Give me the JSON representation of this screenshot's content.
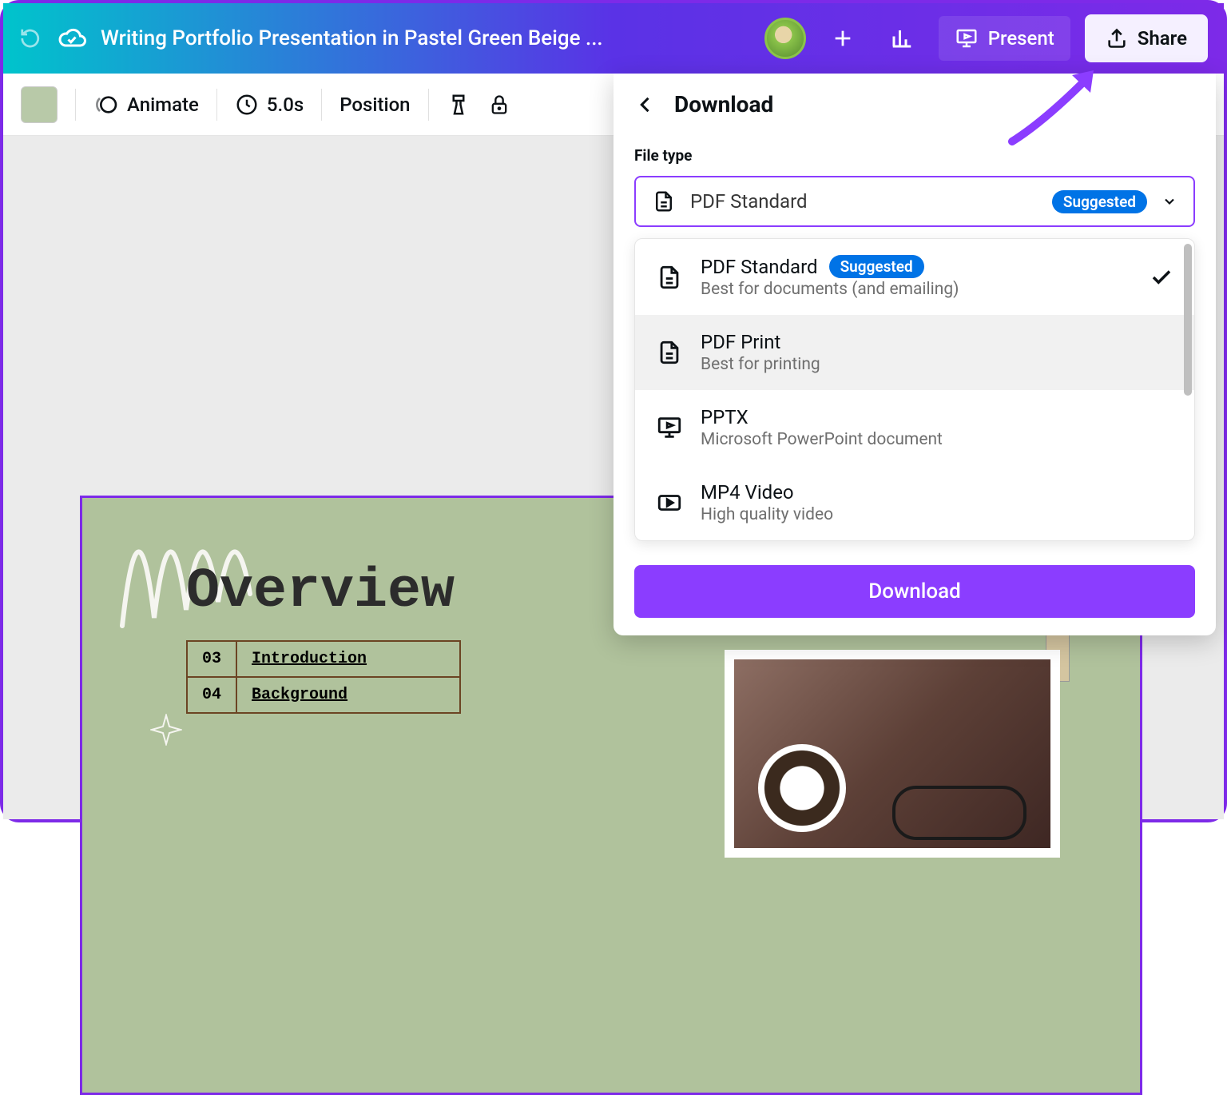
{
  "header": {
    "doc_title": "Writing Portfolio Presentation in Pastel Green Beige ...",
    "present_label": "Present",
    "share_label": "Share"
  },
  "toolbar": {
    "animate_label": "Animate",
    "duration_label": "5.0s",
    "position_label": "Position"
  },
  "panel": {
    "title": "Download",
    "file_type_label": "File type",
    "selected": {
      "label": "PDF Standard",
      "badge": "Suggested"
    },
    "options": [
      {
        "icon": "file",
        "title": "PDF Standard",
        "subtitle": "Best for documents (and emailing)",
        "badge": "Suggested",
        "selected": true
      },
      {
        "icon": "file",
        "title": "PDF Print",
        "subtitle": "Best for printing",
        "hover": true
      },
      {
        "icon": "present",
        "title": "PPTX",
        "subtitle": "Microsoft PowerPoint document"
      },
      {
        "icon": "video",
        "title": "MP4 Video",
        "subtitle": "High quality video"
      }
    ],
    "download_label": "Download"
  },
  "slide": {
    "title": "Overview",
    "rows": [
      {
        "num": "03",
        "label": "Introduction"
      },
      {
        "num": "04",
        "label": "Background"
      }
    ]
  }
}
